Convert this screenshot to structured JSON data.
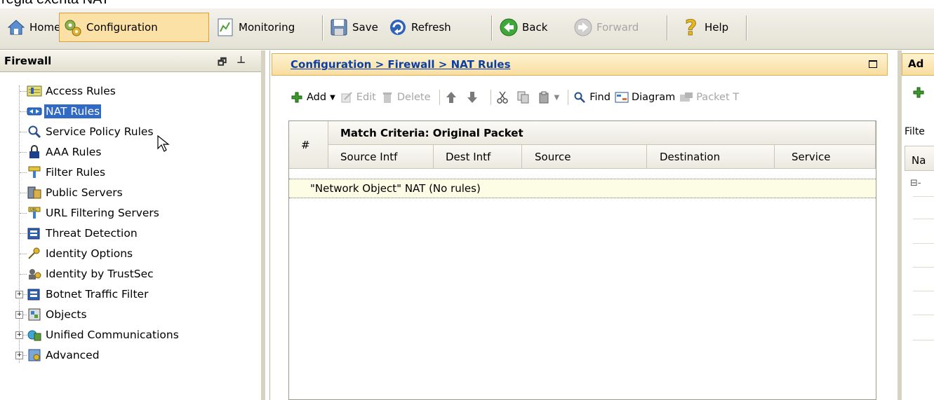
{
  "caption": "regla exenta NAT",
  "toolbar": {
    "items": [
      {
        "label": "Home",
        "icon": "home-icon",
        "active": false,
        "disabled": false
      },
      {
        "label": "Configuration",
        "icon": "configuration-gears-icon",
        "active": true,
        "disabled": false
      },
      {
        "label": "Monitoring",
        "icon": "monitoring-chart-icon",
        "active": false,
        "disabled": false
      },
      {
        "label": "Save",
        "icon": "save-disk-icon",
        "active": false,
        "disabled": false
      },
      {
        "label": "Refresh",
        "icon": "refresh-icon",
        "active": false,
        "disabled": false
      },
      {
        "label": "Back",
        "icon": "back-arrow-icon",
        "active": false,
        "disabled": false
      },
      {
        "label": "Forward",
        "icon": "forward-arrow-icon",
        "active": false,
        "disabled": true
      },
      {
        "label": "Help",
        "icon": "help-question-icon",
        "active": false,
        "disabled": false
      }
    ]
  },
  "nav": {
    "title": "Firewall",
    "items": [
      {
        "label": "Access Rules",
        "icon": "access-rules-icon",
        "selected": false,
        "expandable": false
      },
      {
        "label": "NAT Rules",
        "icon": "nat-rules-icon",
        "selected": true,
        "expandable": false
      },
      {
        "label": "Service Policy Rules",
        "icon": "magnifier-icon",
        "selected": false,
        "expandable": false
      },
      {
        "label": "AAA Rules",
        "icon": "lock-icon",
        "selected": false,
        "expandable": false
      },
      {
        "label": "Filter Rules",
        "icon": "filter-icon",
        "selected": false,
        "expandable": false
      },
      {
        "label": "Public Servers",
        "icon": "server-icon",
        "selected": false,
        "expandable": false
      },
      {
        "label": "URL Filtering Servers",
        "icon": "url-filter-icon",
        "selected": false,
        "expandable": false
      },
      {
        "label": "Threat Detection",
        "icon": "threat-detection-icon",
        "selected": false,
        "expandable": false
      },
      {
        "label": "Identity Options",
        "icon": "identity-key-icon",
        "selected": false,
        "expandable": false
      },
      {
        "label": "Identity by TrustSec",
        "icon": "trustsec-icon",
        "selected": false,
        "expandable": false
      },
      {
        "label": "Botnet Traffic Filter",
        "icon": "botnet-icon",
        "selected": false,
        "expandable": true
      },
      {
        "label": "Objects",
        "icon": "objects-icon",
        "selected": false,
        "expandable": true
      },
      {
        "label": "Unified Communications",
        "icon": "unified-communications-icon",
        "selected": false,
        "expandable": true
      },
      {
        "label": "Advanced",
        "icon": "advanced-icon",
        "selected": false,
        "expandable": true
      }
    ]
  },
  "center": {
    "breadcrumb": "Configuration > Firewall > NAT Rules",
    "toolbar": [
      {
        "label": "Add",
        "icon": "add-plus-icon",
        "disabled": false,
        "dropdown": true
      },
      {
        "label": "Edit",
        "icon": "edit-icon",
        "disabled": true,
        "dropdown": false
      },
      {
        "label": "Delete",
        "icon": "delete-trash-icon",
        "disabled": true,
        "dropdown": false
      },
      {
        "label": "",
        "icon": "move-up-icon",
        "disabled": false,
        "dropdown": false
      },
      {
        "label": "",
        "icon": "move-down-icon",
        "disabled": false,
        "dropdown": false
      },
      {
        "label": "",
        "icon": "cut-icon",
        "disabled": false,
        "dropdown": false
      },
      {
        "label": "",
        "icon": "copy-icon",
        "disabled": false,
        "dropdown": false
      },
      {
        "label": "",
        "icon": "paste-icon",
        "disabled": false,
        "dropdown": true
      },
      {
        "label": "Find",
        "icon": "find-icon",
        "disabled": false,
        "dropdown": false
      },
      {
        "label": "Diagram",
        "icon": "diagram-icon",
        "disabled": false,
        "dropdown": false
      },
      {
        "label": "Packet T",
        "icon": "packet-trace-icon",
        "disabled": true,
        "dropdown": false
      }
    ],
    "grid": {
      "number_col": "#",
      "group_header": "Match Criteria: Original Packet",
      "columns": [
        "Source Intf",
        "Dest Intf",
        "Source",
        "Destination",
        "Service"
      ],
      "rows": [
        "\"Network Object\" NAT (No rules)"
      ]
    }
  },
  "right": {
    "header": "Ad",
    "filter_label": "Filte",
    "column": "Na",
    "tree_node": "⊟-"
  },
  "colors": {
    "selection": "#316ac5",
    "breadcrumb": "#0b3fa6",
    "active_tool": "#fce1a6"
  }
}
